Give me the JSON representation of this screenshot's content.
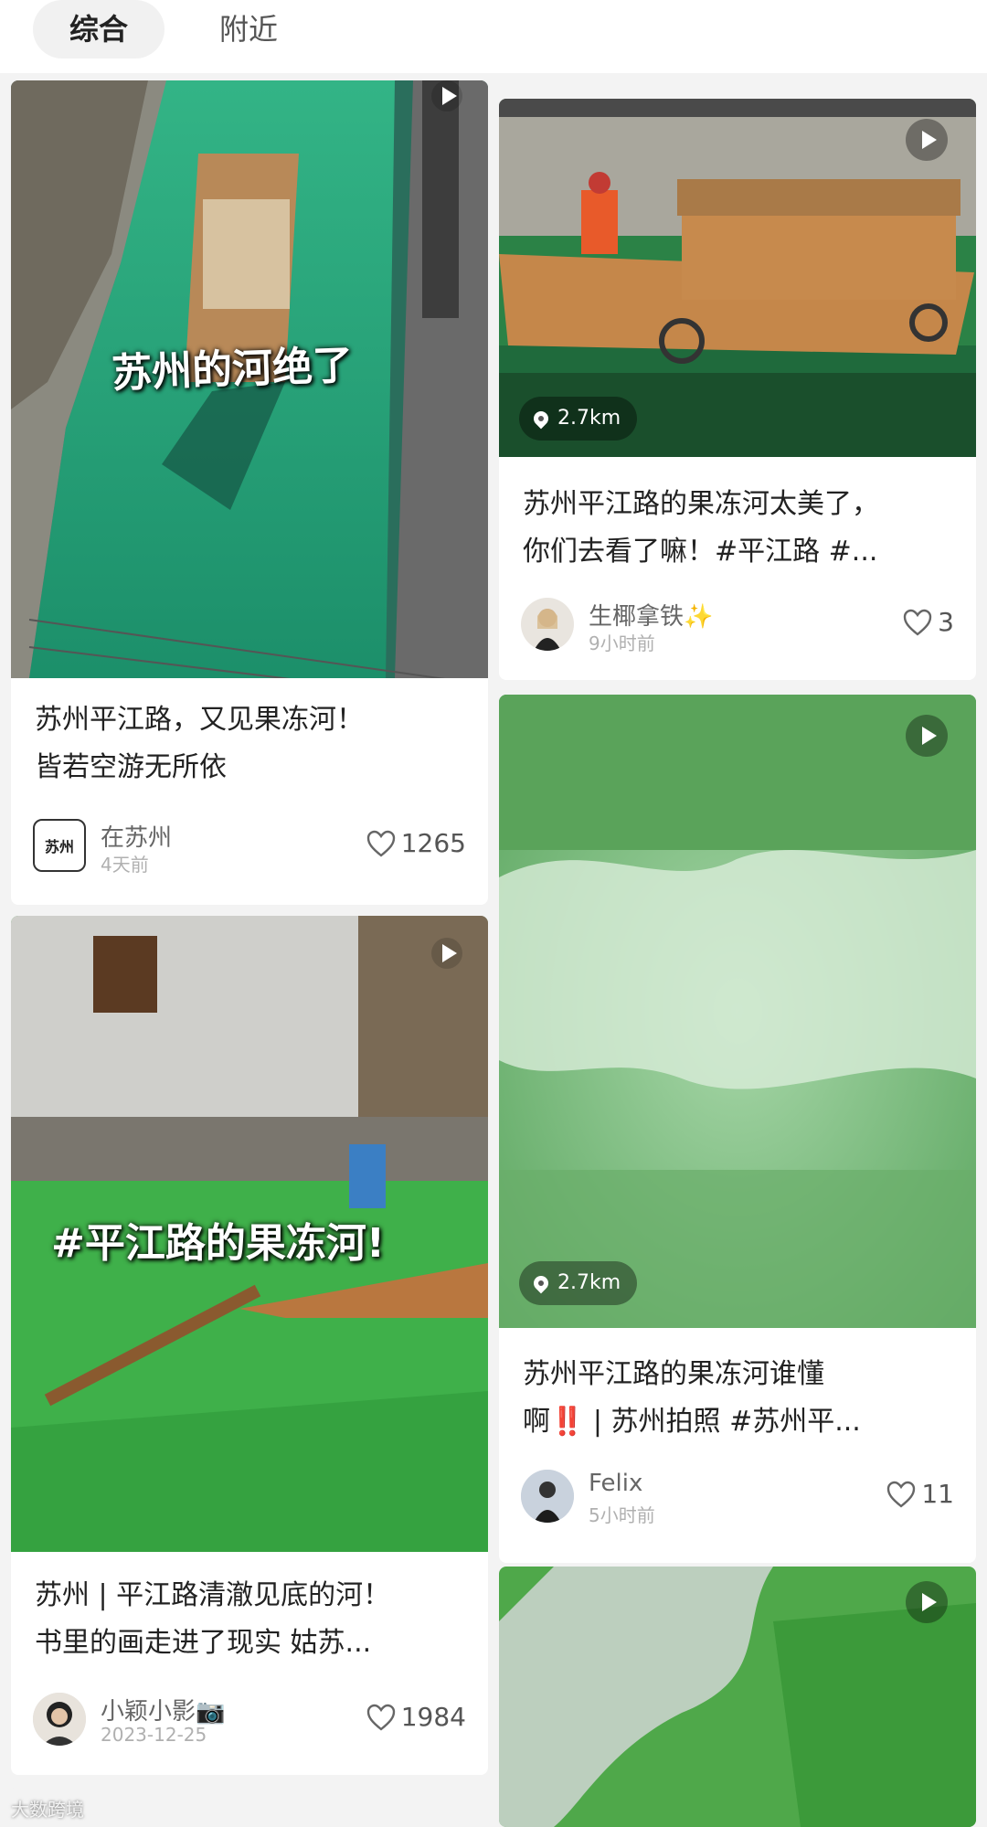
{
  "tabs": [
    {
      "label": "综合"
    },
    {
      "label": "附近"
    }
  ],
  "cards": {
    "c1": {
      "overlay_text": "苏州的河绝了",
      "title_lines": [
        "苏州平江路，又见果冻河！",
        "皆若空游无所依"
      ],
      "author": "在苏州",
      "avatar_text": "苏州",
      "time": "4天前",
      "likes": "1265"
    },
    "c2": {
      "location": "2.7km",
      "title_lines": [
        "苏州平江路的果冻河太美了，",
        "你们去看了嘛！#平江路 #..."
      ],
      "author": "生椰拿铁✨",
      "time": "9小时前",
      "likes": "3"
    },
    "c3": {
      "overlay_text": "#平江路的果冻河!",
      "title_lines": [
        "苏州 | 平江路清澈见底的河！",
        "书里的画走进了现实 姑苏..."
      ],
      "author": "小颖小影📷",
      "time": "2023-12-25",
      "likes": "1984"
    },
    "c4": {
      "location": "2.7km",
      "title_lines": [
        "苏州平江路的果冻河谁懂",
        "啊‼️ | 苏州拍照 #苏州平..."
      ],
      "author": "Felix",
      "time": "5小时前",
      "likes": "11"
    }
  },
  "watermark": "大数跨境"
}
